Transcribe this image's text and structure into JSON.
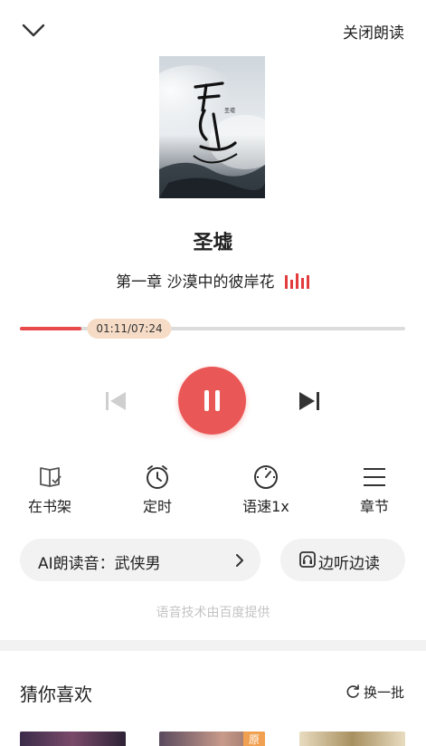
{
  "topbar": {
    "collapse_icon": "chevron-down-icon",
    "close_label": "关闭朗读"
  },
  "book": {
    "title": "圣墟",
    "chapter": "第一章 沙漠中的彼岸花",
    "cover_title_art": "圣墟",
    "playing_indicator_icon": "sound-wave-icon"
  },
  "player": {
    "time_label": "01:11/07:24",
    "progress_fraction": 0.16,
    "prev_icon": "skip-previous-icon",
    "play_state_icon": "pause-icon",
    "next_icon": "skip-next-icon",
    "accent_color": "#ea5757"
  },
  "functions": [
    {
      "label": "在书架",
      "icon": "bookshelf-check-icon"
    },
    {
      "label": "定时",
      "icon": "alarm-clock-icon"
    },
    {
      "label": "语速1x",
      "icon": "speedometer-icon"
    },
    {
      "label": "章节",
      "icon": "menu-list-icon"
    }
  ],
  "voice": {
    "label": "AI朗读音：武侠男",
    "arrow_icon": "chevron-right-icon"
  },
  "listen_read": {
    "label": "边听边读",
    "icon": "headphone-book-icon"
  },
  "credit": "语音技术由百度提供",
  "recommend": {
    "title": "猜你喜欢",
    "refresh_label": "换一批",
    "refresh_icon": "refresh-icon",
    "badge": "原"
  }
}
